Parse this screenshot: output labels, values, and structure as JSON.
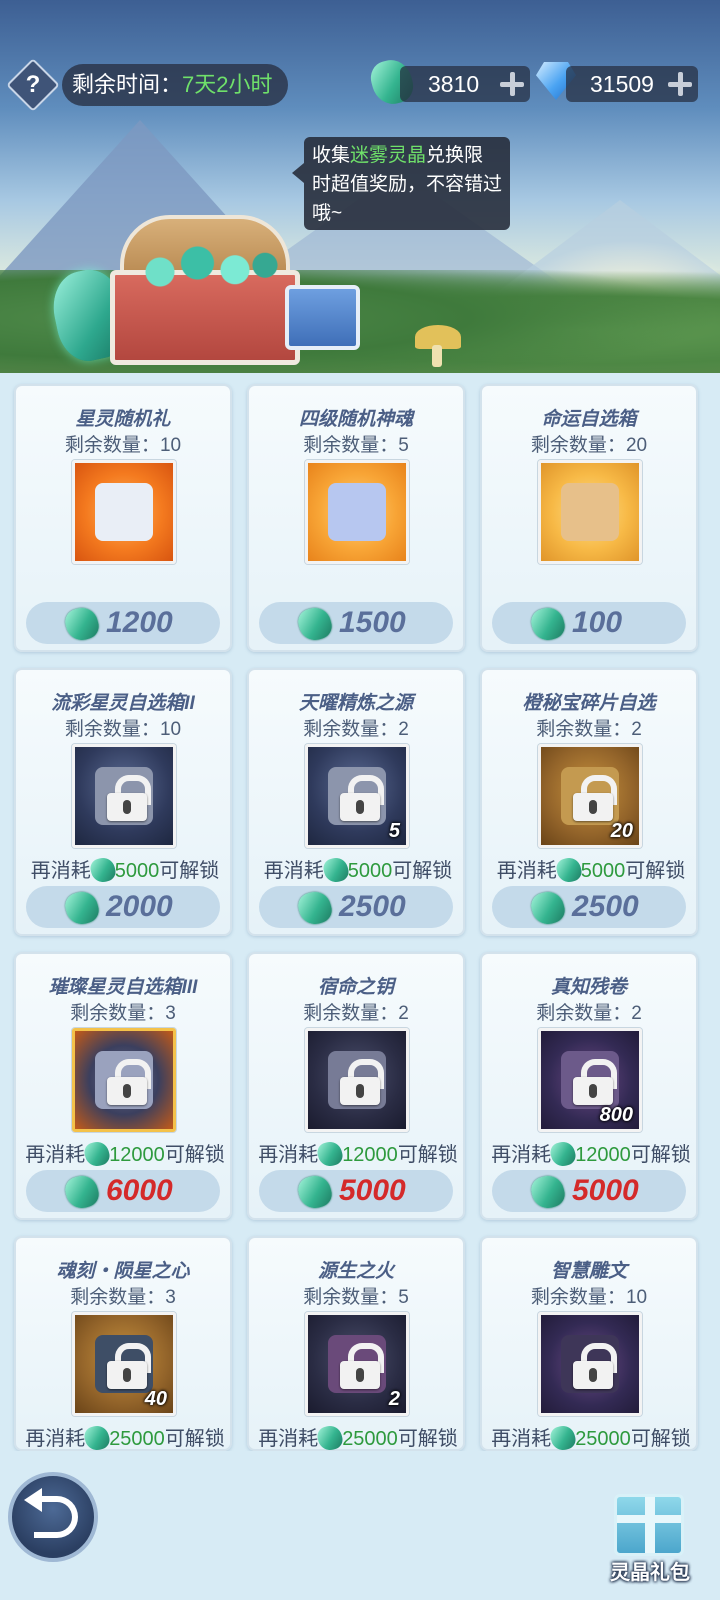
{
  "topbar": {
    "help_label": "?",
    "time_label": "剩余时间：",
    "time_value": "7天2小时",
    "crystal_count": "3810",
    "diamond_count": "31509"
  },
  "tooltip": {
    "prefix": "收集",
    "highlight": "迷雾灵晶",
    "suffix": "兑换限时超值奖励，不容错过哦~"
  },
  "labels": {
    "remain_prefix": "剩余数量：",
    "unlock_prefix": "再消耗",
    "unlock_suffix": "可解锁"
  },
  "items": [
    {
      "title": "星灵随机礼",
      "remain": "10",
      "price": "1200",
      "locked": false,
      "unlock_cost": "",
      "count": ""
    },
    {
      "title": "四级随机神魂",
      "remain": "5",
      "price": "1500",
      "locked": false,
      "unlock_cost": "",
      "count": ""
    },
    {
      "title": "命运自选箱",
      "remain": "20",
      "price": "100",
      "locked": false,
      "unlock_cost": "",
      "count": ""
    },
    {
      "title": "流彩星灵自选箱II",
      "remain": "10",
      "price": "2000",
      "locked": true,
      "unlock_cost": "5000",
      "count": ""
    },
    {
      "title": "天曜精炼之源",
      "remain": "2",
      "price": "2500",
      "locked": true,
      "unlock_cost": "5000",
      "count": "5"
    },
    {
      "title": "橙秘宝碎片自选",
      "remain": "2",
      "price": "2500",
      "locked": true,
      "unlock_cost": "5000",
      "count": "20"
    },
    {
      "title": "璀璨星灵自选箱III",
      "remain": "3",
      "price": "6000",
      "locked": true,
      "unlock_cost": "12000",
      "count": ""
    },
    {
      "title": "宿命之钥",
      "remain": "2",
      "price": "5000",
      "locked": true,
      "unlock_cost": "12000",
      "count": ""
    },
    {
      "title": "真知残卷",
      "remain": "2",
      "price": "5000",
      "locked": true,
      "unlock_cost": "12000",
      "count": "800"
    },
    {
      "title": "魂刻・陨星之心",
      "remain": "3",
      "price": "",
      "locked": true,
      "unlock_cost": "25000",
      "count": "40"
    },
    {
      "title": "源生之火",
      "remain": "5",
      "price": "",
      "locked": true,
      "unlock_cost": "25000",
      "count": "2"
    },
    {
      "title": "智慧雕文",
      "remain": "10",
      "price": "",
      "locked": true,
      "unlock_cost": "25000",
      "count": ""
    }
  ],
  "bottom": {
    "gift_label": "灵晶礼包"
  },
  "colors": {
    "price_normal": "#5a6f9a",
    "price_red": "#d42a2a",
    "highlight_green": "#6fe06a"
  }
}
